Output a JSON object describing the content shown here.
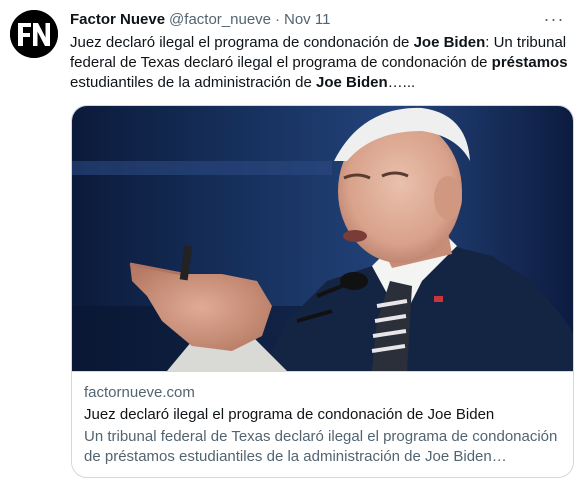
{
  "author": {
    "avatar_text": "FN",
    "name": "Factor Nueve",
    "handle": "@factor_nueve",
    "separator": "·",
    "timestamp": "Nov 11"
  },
  "menu": {
    "more_label": "···"
  },
  "tweet": {
    "text_parts": [
      {
        "text": "Juez declaró ilegal el programa de condonación de ",
        "bold": false
      },
      {
        "text": "Joe Biden",
        "bold": true
      },
      {
        "text": ": Un tribunal federal de Texas declaró ilegal el programa de condonación de ",
        "bold": false
      },
      {
        "text": "préstamos",
        "bold": true
      },
      {
        "text": " estudiantiles de la administración de ",
        "bold": false
      },
      {
        "text": "Joe Biden",
        "bold": true
      },
      {
        "text": "…...",
        "bold": false
      }
    ]
  },
  "card": {
    "domain": "factornueve.com",
    "title": "Juez declaró ilegal el programa de condonación de Joe Biden",
    "description": "Un tribunal federal de Texas declaró ilegal el programa de condonación de préstamos estudiantiles de la administración de Joe Biden…"
  },
  "colors": {
    "text_primary": "#0f1419",
    "text_secondary": "#536471",
    "border": "#cfd9de",
    "background": "#ffffff",
    "avatar_bg": "#000000"
  }
}
